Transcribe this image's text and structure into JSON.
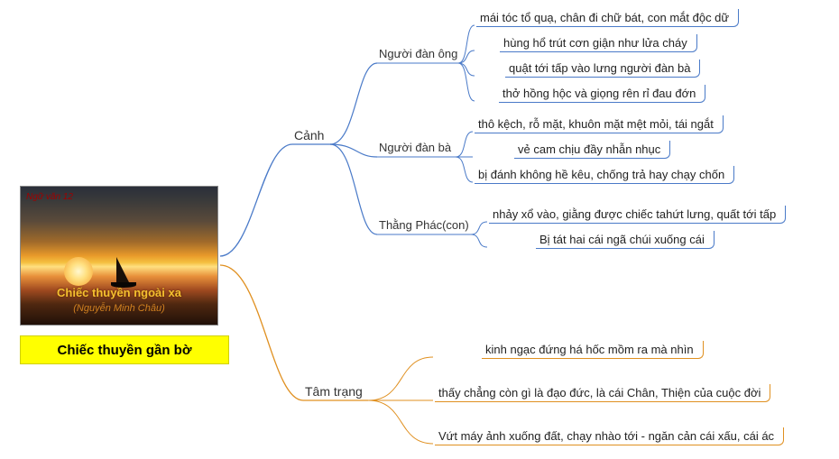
{
  "card": {
    "tag": "Ngữ văn 12",
    "title1": "Chiếc thuyền ngoài xa",
    "title2": "(Nguyễn Minh Châu)"
  },
  "root": {
    "label": "Chiếc thuyền gần bờ"
  },
  "branches": [
    {
      "label": "Cảnh",
      "color": "blue",
      "sub": [
        {
          "label": "Người đàn ông",
          "leaves": [
            "mái tóc tổ quạ, chân đi chữ bát, con mắt độc dữ",
            "hùng hổ trút cơn giận như lửa cháy",
            "quật tới tấp vào lưng người đàn bà",
            "thở hồng hộc và giọng rên rỉ đau đớn"
          ]
        },
        {
          "label": "Người đàn bà",
          "leaves": [
            "thô kệch, rỗ mặt, khuôn mặt mệt mỏi, tái ngắt",
            "vẻ cam chịu đầy nhẫn nhục",
            "bị đánh không hề kêu, chống trả hay chạy chốn"
          ]
        },
        {
          "label": "Thằng Phác(con)",
          "leaves": [
            "nhảy xổ vào, giằng được chiếc tahứt lưng, quất tới tấp",
            "Bị tát hai cái ngã chúi xuống cái"
          ]
        }
      ]
    },
    {
      "label": "Tâm trạng",
      "color": "orange",
      "sub": [],
      "leaves": [
        "kinh ngạc đứng há hốc mồm ra mà nhìn",
        "thấy chẳng còn gì là đạo đức, là cái Chân, Thiện của cuộc đời",
        "Vứt máy ảnh xuống đất, chạy nhào tới - ngăn cản cái xấu, cái ác"
      ]
    }
  ]
}
